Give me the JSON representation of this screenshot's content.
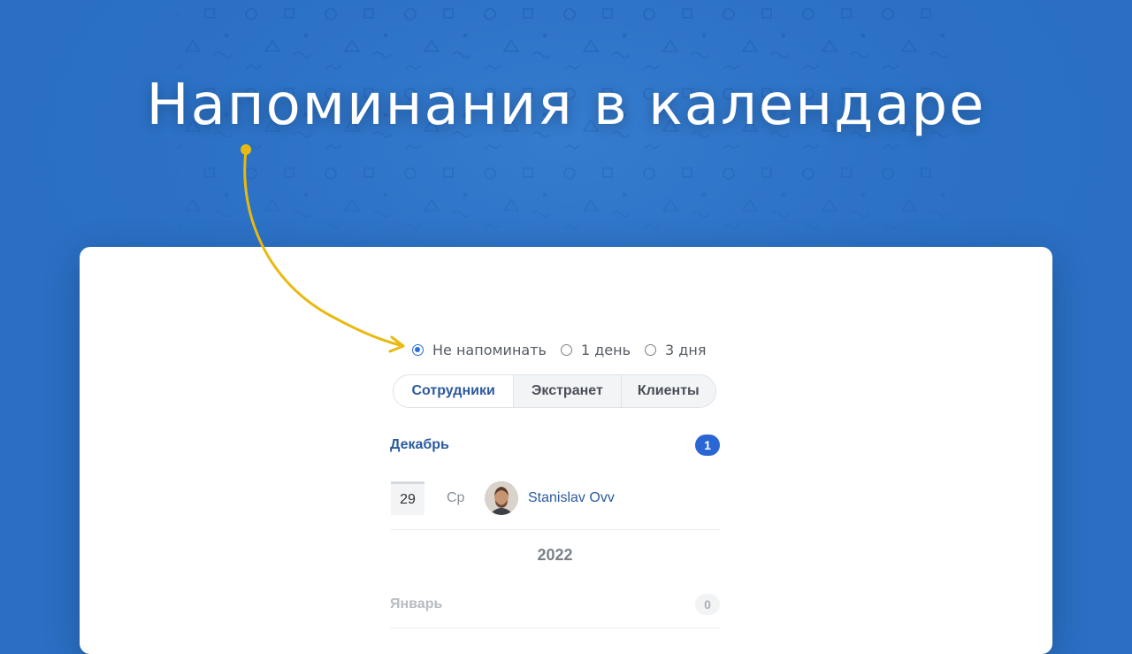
{
  "headline": "Напоминания в календаре",
  "reminder": {
    "options": [
      "Не напоминать",
      "1 день",
      "3 дня"
    ],
    "selected_index": 0
  },
  "tabs": [
    "Сотрудники",
    "Экстранет",
    "Клиенты"
  ],
  "active_tab_index": 0,
  "months": [
    {
      "name": "Декабрь",
      "count": "1"
    },
    {
      "name": "Январь",
      "count": "0"
    }
  ],
  "event": {
    "day": "29",
    "weekday": "Ср",
    "person": "Stanislav Ovv"
  },
  "year_label": "2022",
  "colors": {
    "background": "#2a6fc4",
    "accent": "#2a66d4",
    "arrow": "#e8b90f",
    "link": "#2c5a9e"
  }
}
